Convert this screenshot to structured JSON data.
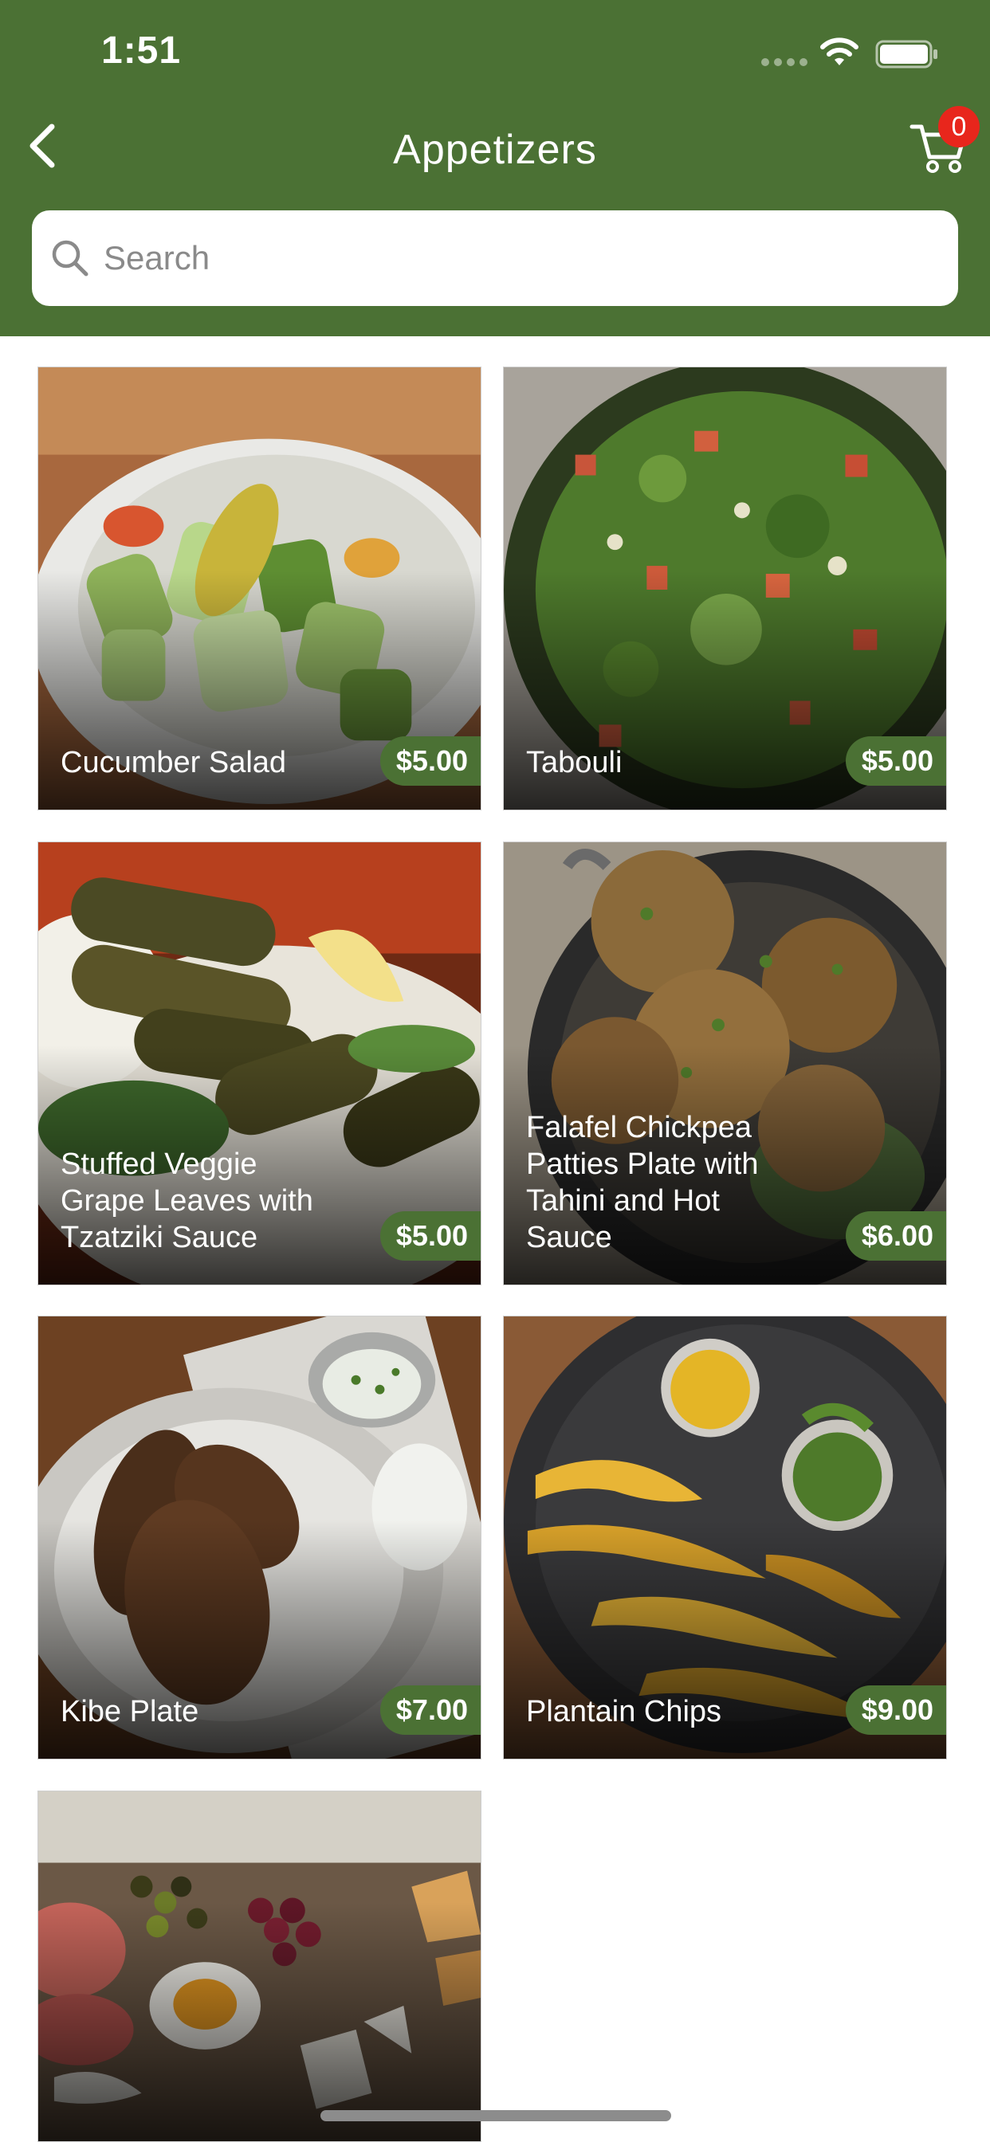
{
  "status_bar": {
    "time": "1:51"
  },
  "header": {
    "title": "Appetizers",
    "cart_count": "0"
  },
  "search": {
    "placeholder": "Search"
  },
  "items": [
    {
      "name": "Cucumber Salad",
      "price": "$5.00"
    },
    {
      "name": "Tabouli",
      "price": "$5.00"
    },
    {
      "name": "Stuffed Veggie Grape Leaves with Tzatziki Sauce",
      "price": "$5.00"
    },
    {
      "name": "Falafel Chickpea Patties Plate with Tahini and Hot Sauce",
      "price": "$6.00"
    },
    {
      "name": "Kibe Plate",
      "price": "$7.00"
    },
    {
      "name": "Plantain Chips",
      "price": "$9.00"
    }
  ],
  "colors": {
    "brand_green": "#4b7134",
    "badge_red": "#e8261c"
  },
  "icons": {
    "back": "chevron-left-icon",
    "cart": "cart-icon",
    "search": "search-icon"
  }
}
